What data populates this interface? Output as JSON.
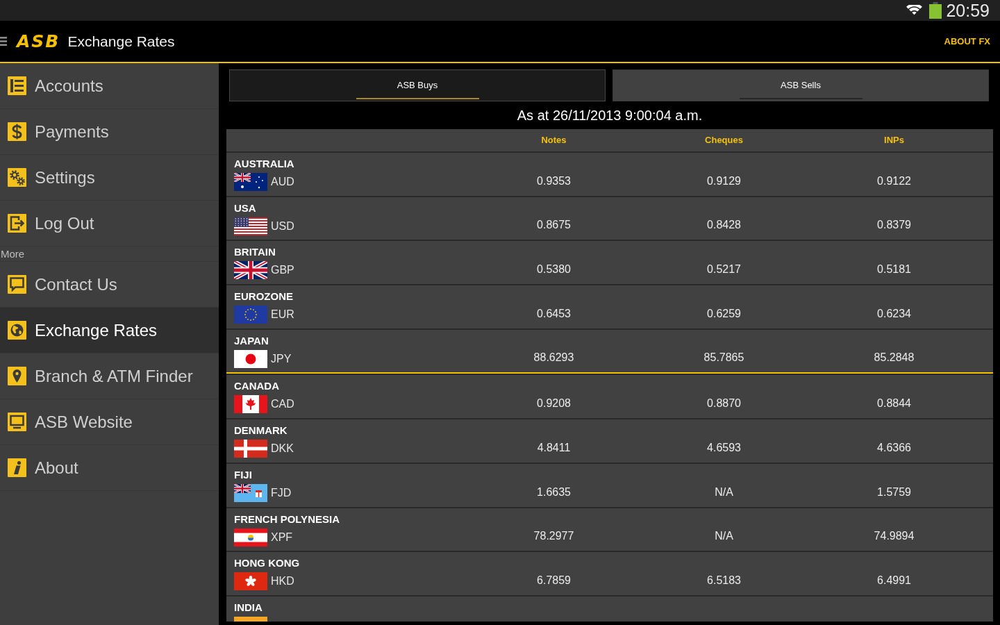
{
  "status_bar": {
    "time": "20:59"
  },
  "app_bar": {
    "logo": "ASB",
    "title": "Exchange Rates",
    "action": "ABOUT FX"
  },
  "sidebar": {
    "sections": [
      {
        "items": [
          {
            "label": "Accounts",
            "selected": false
          },
          {
            "label": "Payments",
            "selected": false
          },
          {
            "label": "Settings",
            "selected": false
          },
          {
            "label": "Log Out",
            "selected": false
          }
        ]
      },
      {
        "heading": "More",
        "items": [
          {
            "label": "Contact Us",
            "selected": false
          },
          {
            "label": "Exchange Rates",
            "selected": true
          },
          {
            "label": "Branch & ATM Finder",
            "selected": false
          },
          {
            "label": "ASB Website",
            "selected": false
          },
          {
            "label": "About",
            "selected": false
          }
        ]
      }
    ]
  },
  "tabs": [
    {
      "label": "ASB Buys",
      "selected": true
    },
    {
      "label": "ASB Sells",
      "selected": false
    }
  ],
  "rates": {
    "timestamp": "As at 26/11/2013 9:00:04 a.m.",
    "columns": [
      "Notes",
      "Cheques",
      "INPs"
    ],
    "groups": [
      {
        "rows": [
          {
            "country": "AUSTRALIA",
            "code": "AUD",
            "values": [
              "0.9353",
              "0.9129",
              "0.9122"
            ]
          },
          {
            "country": "USA",
            "code": "USD",
            "values": [
              "0.8675",
              "0.8428",
              "0.8379"
            ]
          },
          {
            "country": "BRITAIN",
            "code": "GBP",
            "values": [
              "0.5380",
              "0.5217",
              "0.5181"
            ]
          },
          {
            "country": "EUROZONE",
            "code": "EUR",
            "values": [
              "0.6453",
              "0.6259",
              "0.6234"
            ]
          },
          {
            "country": "JAPAN",
            "code": "JPY",
            "values": [
              "88.6293",
              "85.7865",
              "85.2848"
            ]
          }
        ]
      },
      {
        "rows": [
          {
            "country": "CANADA",
            "code": "CAD",
            "values": [
              "0.9208",
              "0.8870",
              "0.8844"
            ]
          },
          {
            "country": "DENMARK",
            "code": "DKK",
            "values": [
              "4.8411",
              "4.6593",
              "4.6366"
            ]
          },
          {
            "country": "FIJI",
            "code": "FJD",
            "values": [
              "1.6635",
              "N/A",
              "1.5759"
            ]
          },
          {
            "country": "FRENCH POLYNESIA",
            "code": "XPF",
            "values": [
              "78.2977",
              "N/A",
              "74.9894"
            ]
          },
          {
            "country": "HONG KONG",
            "code": "HKD",
            "values": [
              "6.7859",
              "6.5183",
              "6.4991"
            ]
          },
          {
            "country": "INDIA"
          }
        ]
      }
    ]
  }
}
